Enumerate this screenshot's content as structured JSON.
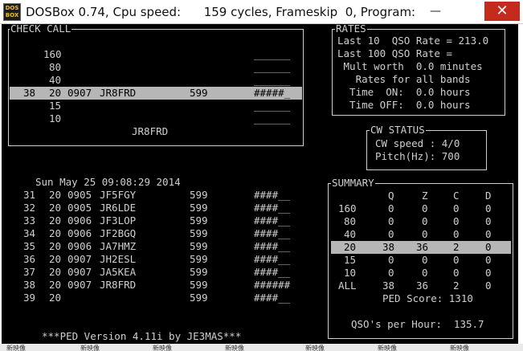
{
  "window": {
    "icon_label": "DOS BOX",
    "title": "DOSBox 0.74, Cpu speed:      159 cycles, Frameskip  0, Program:",
    "minimize": "—",
    "close": "✕"
  },
  "check_call": {
    "title": "CHECK CALL",
    "rows": [
      {
        "num": "",
        "col": "160",
        "call": "",
        "rst": "",
        "mark": "______"
      },
      {
        "num": "",
        "col": "80",
        "call": "",
        "rst": "",
        "mark": "______"
      },
      {
        "num": "",
        "col": "40",
        "call": "",
        "rst": "",
        "mark": "______"
      },
      {
        "num": "38",
        "col": "20",
        "time": "0907",
        "call": "JR8FRD",
        "rst": "599",
        "mark": "#####_"
      },
      {
        "num": "",
        "col": "15",
        "call": "",
        "rst": "",
        "mark": "______"
      },
      {
        "num": "",
        "col": "10",
        "call": "",
        "rst": "",
        "mark": "______"
      }
    ],
    "current_call": "JR8FRD"
  },
  "rates": {
    "title": "RATES",
    "lines": [
      "Last 10  QSO Rate = 213.0",
      "Last 100 QSO Rate =",
      " Mult worth  0.0 minutes",
      "   Rates for all bands",
      "  Time  ON:  0.0 hours",
      "  Time OFF:  0.0 hours"
    ]
  },
  "cw_status": {
    "title": "CW STATUS",
    "speed": "CW speed : 4/0",
    "pitch": "Pitch(Hz): 700"
  },
  "log": {
    "datetime": "Sun May 25 09:08:29 2014",
    "rows": [
      {
        "num": "31",
        "band": "20",
        "time": "0905",
        "call": "JF5FGY",
        "rst": "599",
        "mark": "####__"
      },
      {
        "num": "32",
        "band": "20",
        "time": "0905",
        "call": "JR6LDE",
        "rst": "599",
        "mark": "####__"
      },
      {
        "num": "33",
        "band": "20",
        "time": "0906",
        "call": "JF3LOP",
        "rst": "599",
        "mark": "####__"
      },
      {
        "num": "34",
        "band": "20",
        "time": "0906",
        "call": "JF2BGQ",
        "rst": "599",
        "mark": "####__"
      },
      {
        "num": "35",
        "band": "20",
        "time": "0906",
        "call": "JA7HMZ",
        "rst": "599",
        "mark": "####__"
      },
      {
        "num": "36",
        "band": "20",
        "time": "0907",
        "call": "JH2ESL",
        "rst": "599",
        "mark": "####__"
      },
      {
        "num": "37",
        "band": "20",
        "time": "0907",
        "call": "JA5KEA",
        "rst": "599",
        "mark": "####__"
      },
      {
        "num": "38",
        "band": "20",
        "time": "0907",
        "call": "JR8FRD",
        "rst": "599",
        "mark": "######"
      },
      {
        "num": "39",
        "band": "20",
        "time": "",
        "call": "",
        "rst": "599",
        "mark": "####__"
      }
    ],
    "version": "***PED Version 4.11i by JE3MAS***"
  },
  "summary": {
    "title": "SUMMARY",
    "headers": [
      "",
      "Q",
      "Z",
      "C",
      "D"
    ],
    "rows": [
      [
        "160",
        "0",
        "0",
        "0",
        "0"
      ],
      [
        "80",
        "0",
        "0",
        "0",
        "0"
      ],
      [
        "40",
        "0",
        "0",
        "0",
        "0"
      ],
      [
        "20",
        "38",
        "36",
        "2",
        "0"
      ],
      [
        "15",
        "0",
        "0",
        "0",
        "0"
      ],
      [
        "10",
        "0",
        "0",
        "0",
        "0"
      ],
      [
        "ALL",
        "38",
        "36",
        "2",
        "0"
      ]
    ],
    "score": "PED Score: 1310",
    "qso_per_hour": "QSO's per Hour:  135.7"
  },
  "taskbar": {
    "items": [
      "新映像",
      "新映像",
      "新映像",
      "新映像",
      "新映像",
      "新映像",
      "新映像"
    ]
  },
  "colors": {
    "screen_bg": "#000000",
    "text": "#cfcfcf",
    "highlight": "#b6b6b6",
    "title_close": "#c42b1c"
  }
}
